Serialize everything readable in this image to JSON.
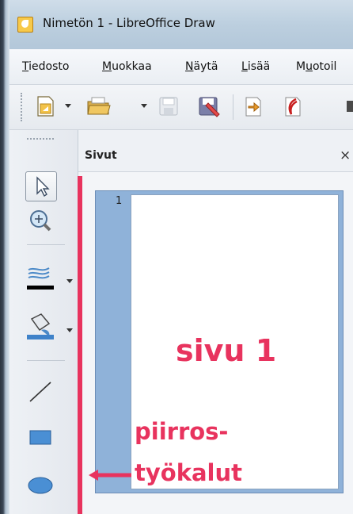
{
  "window": {
    "title": "Nimetön 1 - LibreOffice Draw",
    "app_icon": "libreoffice-draw-icon"
  },
  "menubar": {
    "items": [
      {
        "label": "Tiedosto",
        "accel": "T",
        "rest": "iedosto"
      },
      {
        "label": "Muokkaa",
        "accel": "M",
        "rest": "uokkaa"
      },
      {
        "label": "Näytä",
        "accel": "N",
        "rest": "äytä"
      },
      {
        "label": "Lisää",
        "accel": "L",
        "rest": "isää"
      },
      {
        "label": "Muotoil",
        "accel_prefix": "M",
        "accel": "u",
        "rest": "otoil"
      }
    ]
  },
  "toolbar": {
    "buttons": [
      "new-document-icon",
      "open-folder-icon",
      "save-icon",
      "export-icon",
      "export-pdf-icon"
    ]
  },
  "tools_sidebar": {
    "tools": [
      "select-arrow-icon",
      "zoom-icon",
      "line-style-icon",
      "area-fill-icon",
      "line-tool-icon",
      "rectangle-icon",
      "ellipse-icon"
    ]
  },
  "pages_panel": {
    "title": "Sivut",
    "close": "×",
    "page_number": "1"
  },
  "annotations": {
    "page_label": "sivu 1",
    "tools_label_line1": "piirros-",
    "tools_label_line2": "työkalut",
    "color": "#e8335e"
  }
}
